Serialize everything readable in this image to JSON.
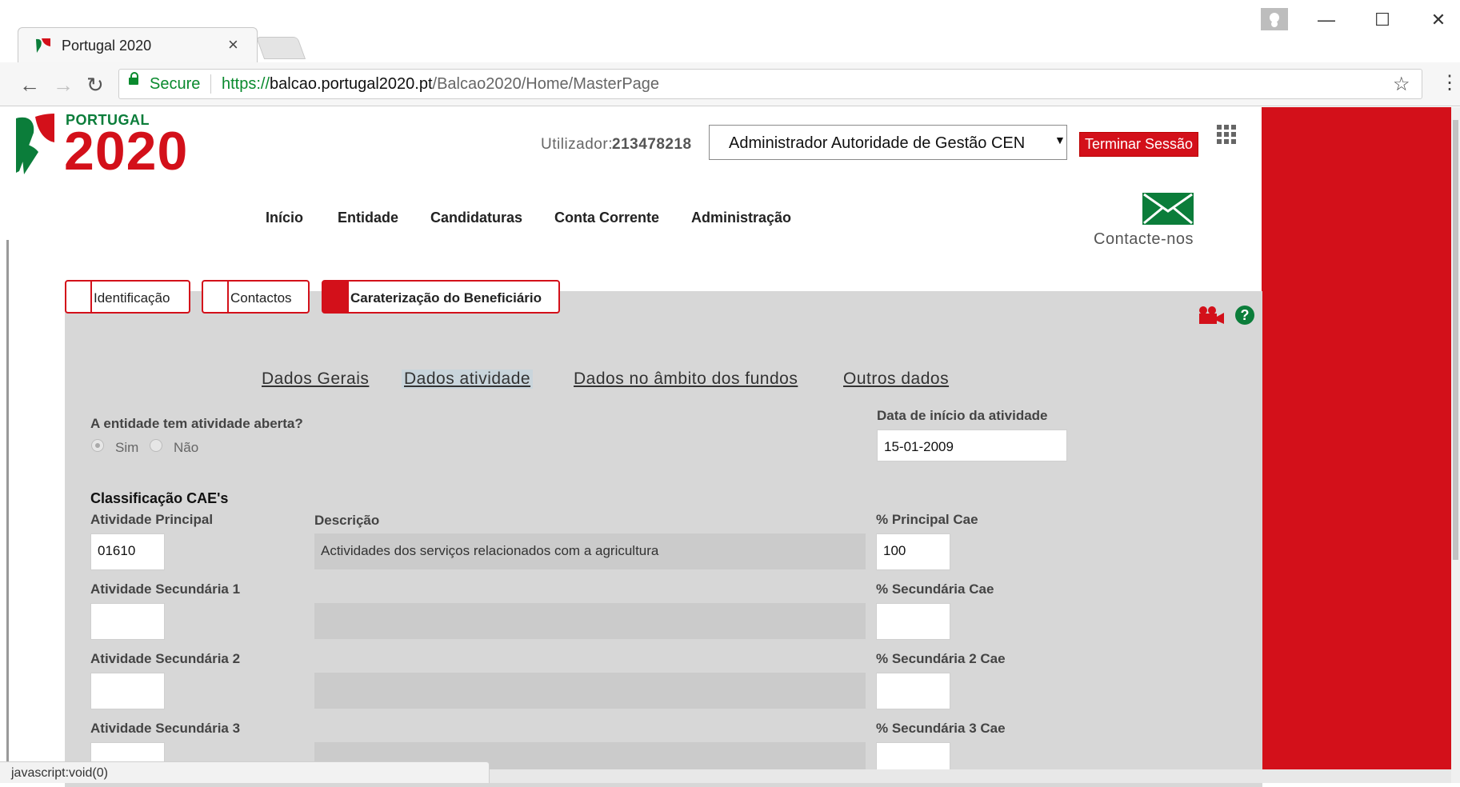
{
  "browser": {
    "tab_title": "Portugal 2020",
    "tab_close": "×",
    "secure_label": "Secure",
    "url_scheme": "https://",
    "url_host": "balcao.portugal2020.pt",
    "url_path": "/Balcao2020/Home/MasterPage",
    "status_text": "javascript:void(0)"
  },
  "header": {
    "logo_small": "PORTUGAL",
    "logo_big": "2020",
    "user_label": "Utilizador:",
    "user_id": "213478218",
    "profile_selected": "Administrador Autoridade de Gestão CEN",
    "logout_label": "Terminar Sessão",
    "contact_label": "Contacte-nos"
  },
  "nav": {
    "items": [
      "Início",
      "Entidade",
      "Candidaturas",
      "Conta Corrente",
      "Administração"
    ]
  },
  "steps": {
    "items": [
      "Identificação",
      "Contactos",
      "Caraterização do Beneficiário"
    ],
    "active_index": 2
  },
  "subtabs": {
    "items": [
      "Dados Gerais",
      "Dados atividade",
      "Dados no âmbito dos fundos",
      "Outros dados"
    ],
    "active_index": 1
  },
  "form": {
    "open_activity_label": "A entidade tem atividade aberta?",
    "yes_label": "Sim",
    "no_label": "Não",
    "yes_selected": true,
    "start_date_label": "Data de início da atividade",
    "start_date_value": "15-01-2009",
    "cae_title": "Classificação CAE's",
    "description_label": "Descrição",
    "rows": [
      {
        "activity_label": "Atividade Principal",
        "activity_value": "01610",
        "description": "Actividades dos serviços relacionados com a agricultura",
        "pct_label": "% Principal Cae",
        "pct_value": "100"
      },
      {
        "activity_label": "Atividade Secundária 1",
        "activity_value": "",
        "description": "",
        "pct_label": "% Secundária Cae",
        "pct_value": ""
      },
      {
        "activity_label": "Atividade Secundária 2",
        "activity_value": "",
        "description": "",
        "pct_label": "% Secundária 2 Cae",
        "pct_value": ""
      },
      {
        "activity_label": "Atividade Secundária 3",
        "activity_value": "",
        "description": "",
        "pct_label": "% Secundária 3 Cae",
        "pct_value": ""
      }
    ]
  },
  "colors": {
    "brand_red": "#d3101a",
    "brand_green": "#0b7d3a",
    "content_bg": "#d7d7d7"
  }
}
